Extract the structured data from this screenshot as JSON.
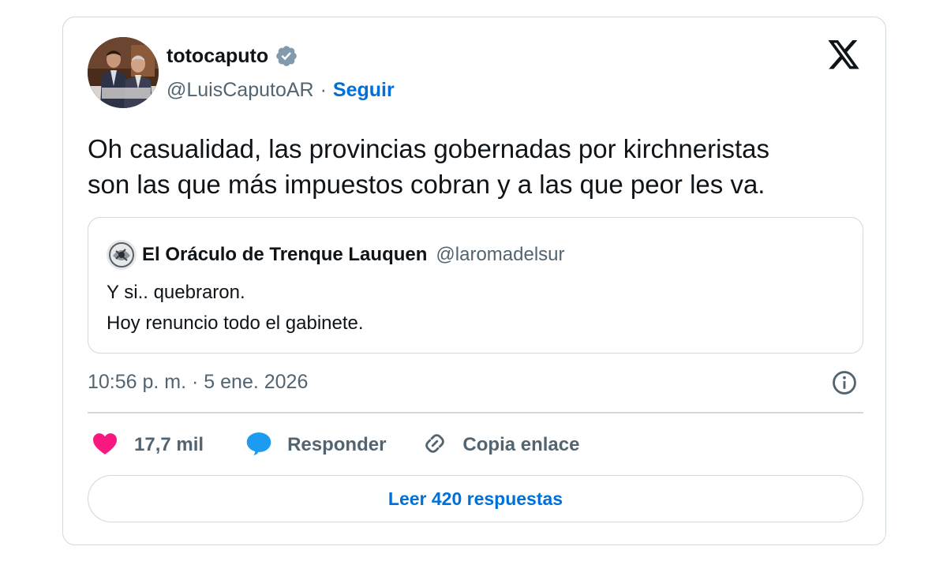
{
  "author": {
    "display_name": "totocaputo",
    "handle": "@LuisCaputoAR",
    "separator": "·",
    "follow_label": "Seguir",
    "verified_icon": "verified-badge-icon"
  },
  "tweet": {
    "text_line1": "Oh casualidad, las provincias gobernadas por kirchneristas",
    "text_line2": "son las que más impuestos cobran y a las que peor les va."
  },
  "quote": {
    "name": "El Oráculo de Trenque Lauquen",
    "handle": "@laromadelsur",
    "line1": "Y si.. quebraron.",
    "line2": "Hoy renuncio todo el gabinete."
  },
  "timestamp": "10:56 p. m. · 5 ene. 2026",
  "actions": {
    "likes": "17,7 mil",
    "reply": "Responder",
    "copy_link": "Copia enlace"
  },
  "read_replies": "Leer 420 respuestas",
  "colors": {
    "accent": "#006fd6",
    "like": "#f91880",
    "reply_bubble": "#1d9bf0",
    "secondary_text": "#536471",
    "border": "#cfd9de"
  }
}
